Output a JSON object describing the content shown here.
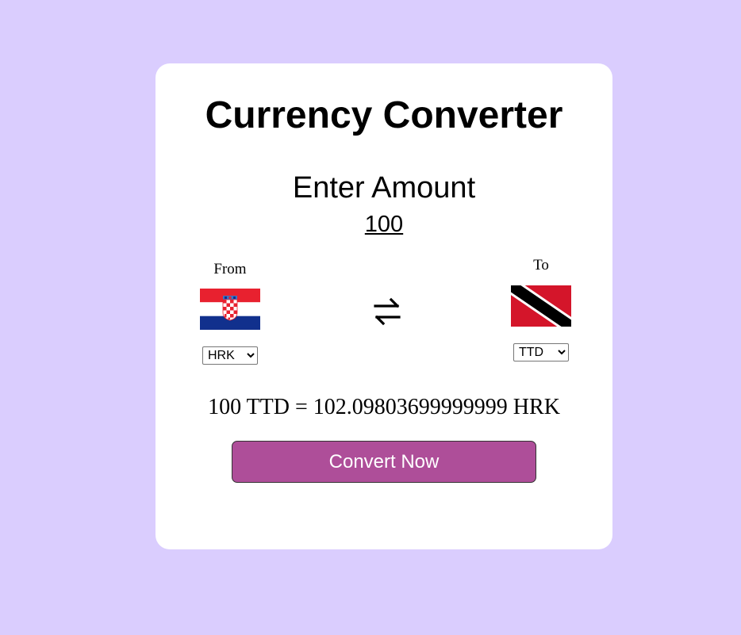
{
  "app": {
    "title": "Currency Converter"
  },
  "amount": {
    "label": "Enter Amount",
    "value": "100"
  },
  "from": {
    "label": "From",
    "flag_icon": "croatia-flag-icon",
    "currency": "HRK"
  },
  "to": {
    "label": "To",
    "flag_icon": "trinidad-and-tobago-flag-icon",
    "currency": "TTD"
  },
  "swap": {
    "icon": "swap-arrows-icon"
  },
  "result": {
    "text": "100 TTD = 102.09803699999999 HRK"
  },
  "convert_button": {
    "label": "Convert Now"
  },
  "colors": {
    "background": "#dacdfe",
    "card": "#ffffff",
    "button": "#ae4e99"
  }
}
